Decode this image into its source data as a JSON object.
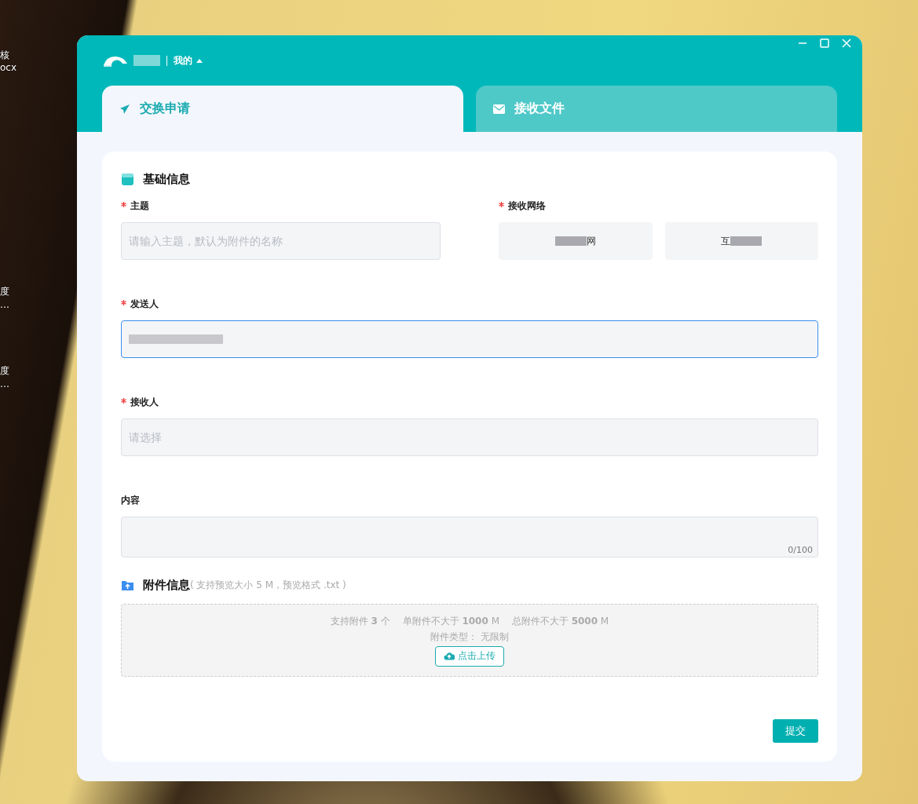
{
  "desktop_labels": [
    {
      "text": "核"
    },
    {
      "text": "ocx"
    },
    {
      "text": "度"
    },
    {
      "text": "…"
    },
    {
      "text": "度"
    },
    {
      "text": "…"
    }
  ],
  "window": {
    "user_menu": "我的"
  },
  "tabs": [
    {
      "label": "交换申请",
      "selected": true,
      "kind": "send"
    },
    {
      "label": "接收文件",
      "selected": false,
      "kind": "mail"
    }
  ],
  "basic_section": {
    "title": "基础信息"
  },
  "subject": {
    "label": "主题",
    "required": true,
    "placeholder": "请输入主题，默认为附件的名称"
  },
  "network": {
    "label": "接收网络",
    "required": true,
    "options": [
      {
        "text": "网",
        "kind": "maskbefore"
      },
      {
        "text": "互",
        "kind": "maskafter"
      }
    ]
  },
  "sender": {
    "label": "发送人",
    "required": true,
    "focused": true
  },
  "receiver": {
    "label": "接收人",
    "required": true,
    "placeholder": "请选择"
  },
  "content": {
    "label": "内容",
    "required": false,
    "counter": "0/100"
  },
  "attachment": {
    "title": "附件信息",
    "hint": "( 支持预览大小 5 M，预览格式 .txt )",
    "limits": "支持附件 **3** 个　 单附件不大于 **1000** M　 总附件不大于 **5000** M",
    "types": "附件类型：  无限制",
    "upload": "点击上传"
  },
  "submit": "提交"
}
